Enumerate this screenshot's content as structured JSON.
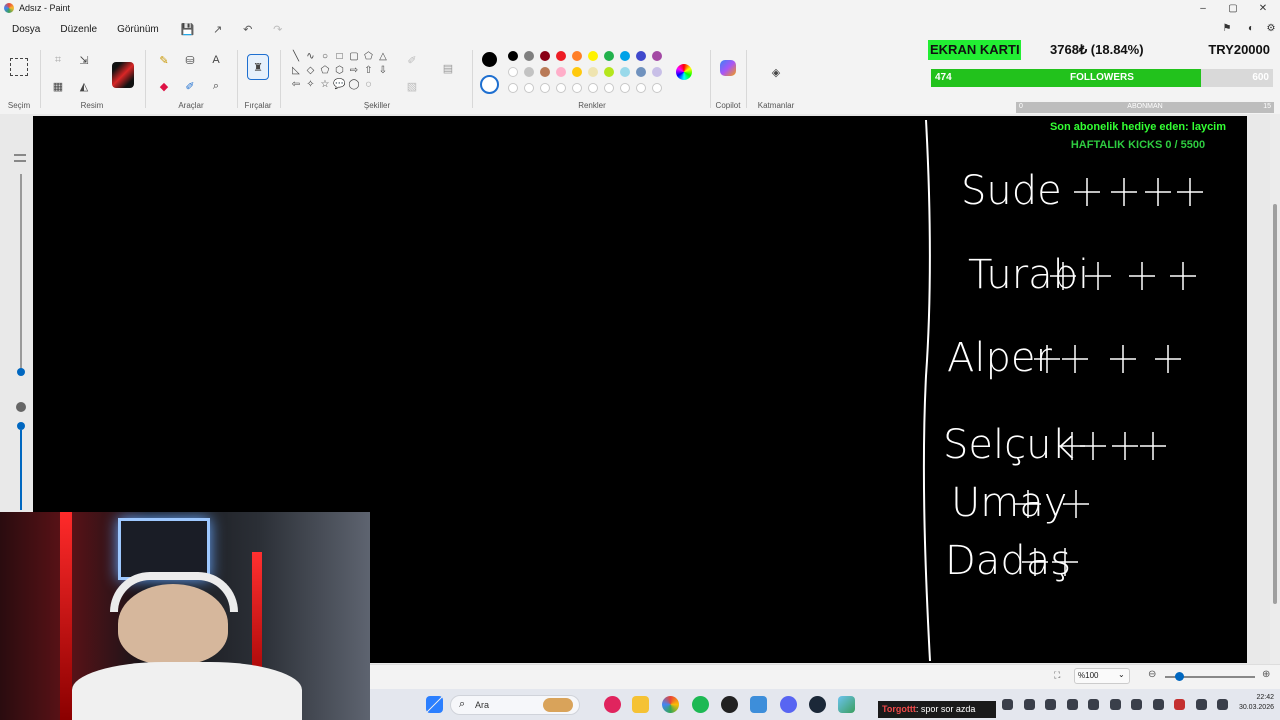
{
  "window": {
    "title": "Adsız - Paint",
    "controls": [
      "–",
      "▢",
      "✕"
    ]
  },
  "menu": {
    "items": [
      "Dosya",
      "Düzenle",
      "Görünüm"
    ]
  },
  "ribbon": {
    "groups": {
      "selection": "Seçim",
      "image": "Resim",
      "tools": "Araçlar",
      "brushes": "Fırçalar",
      "shapes": "Şekiller",
      "colors": "Renkler",
      "copilot": "Copilot",
      "layers": "Katmanlar"
    },
    "palette": [
      "#000000",
      "#7f7f7f",
      "#880015",
      "#ed1c24",
      "#ff7f27",
      "#fff200",
      "#22b14c",
      "#00a2e8",
      "#3f48cc",
      "#a349a4",
      "#ffffff",
      "#c3c3c3",
      "#b97a57",
      "#ffaec9",
      "#ffc90e",
      "#efe4b0",
      "#b5e61d",
      "#99d9ea",
      "#7092be",
      "#c8bfe7"
    ],
    "primary_color": "#000000",
    "secondary_color": "#ffffff"
  },
  "overlay": {
    "gpu_label": "EKRAN KARTI",
    "gpu_amount": "3768₺ (18.84%)",
    "gpu_goal": "TRY20000",
    "gpu_progress": 0.1884,
    "followers_label": "FOLLOWERS",
    "followers_current": "474",
    "followers_goal": "600",
    "followers_progress": 0.79,
    "sub_label": "ABONMAN",
    "sub_current": "0",
    "sub_goal": "15",
    "gift_text": "Son abonelik hediye eden: laycim",
    "kicks_text": "HAFTALIK KICKS 0 / 5500"
  },
  "canvas_text": {
    "names": [
      "Sude",
      "Turabi",
      "Alper",
      "Selçuk",
      "Umay",
      "Dadaş"
    ]
  },
  "statusbar": {
    "zoom": "%100"
  },
  "taskbar": {
    "search_label": "Ara",
    "chat_nick": "Torgottt",
    "chat_message": ": spor sor azda",
    "time": "22:42",
    "date": "30.03.2026"
  },
  "colors": {
    "accent": "#0067c0",
    "followers_green": "#22c21c",
    "gpu_green": "#22ee33",
    "overlay_text_green": "#33ff33"
  }
}
